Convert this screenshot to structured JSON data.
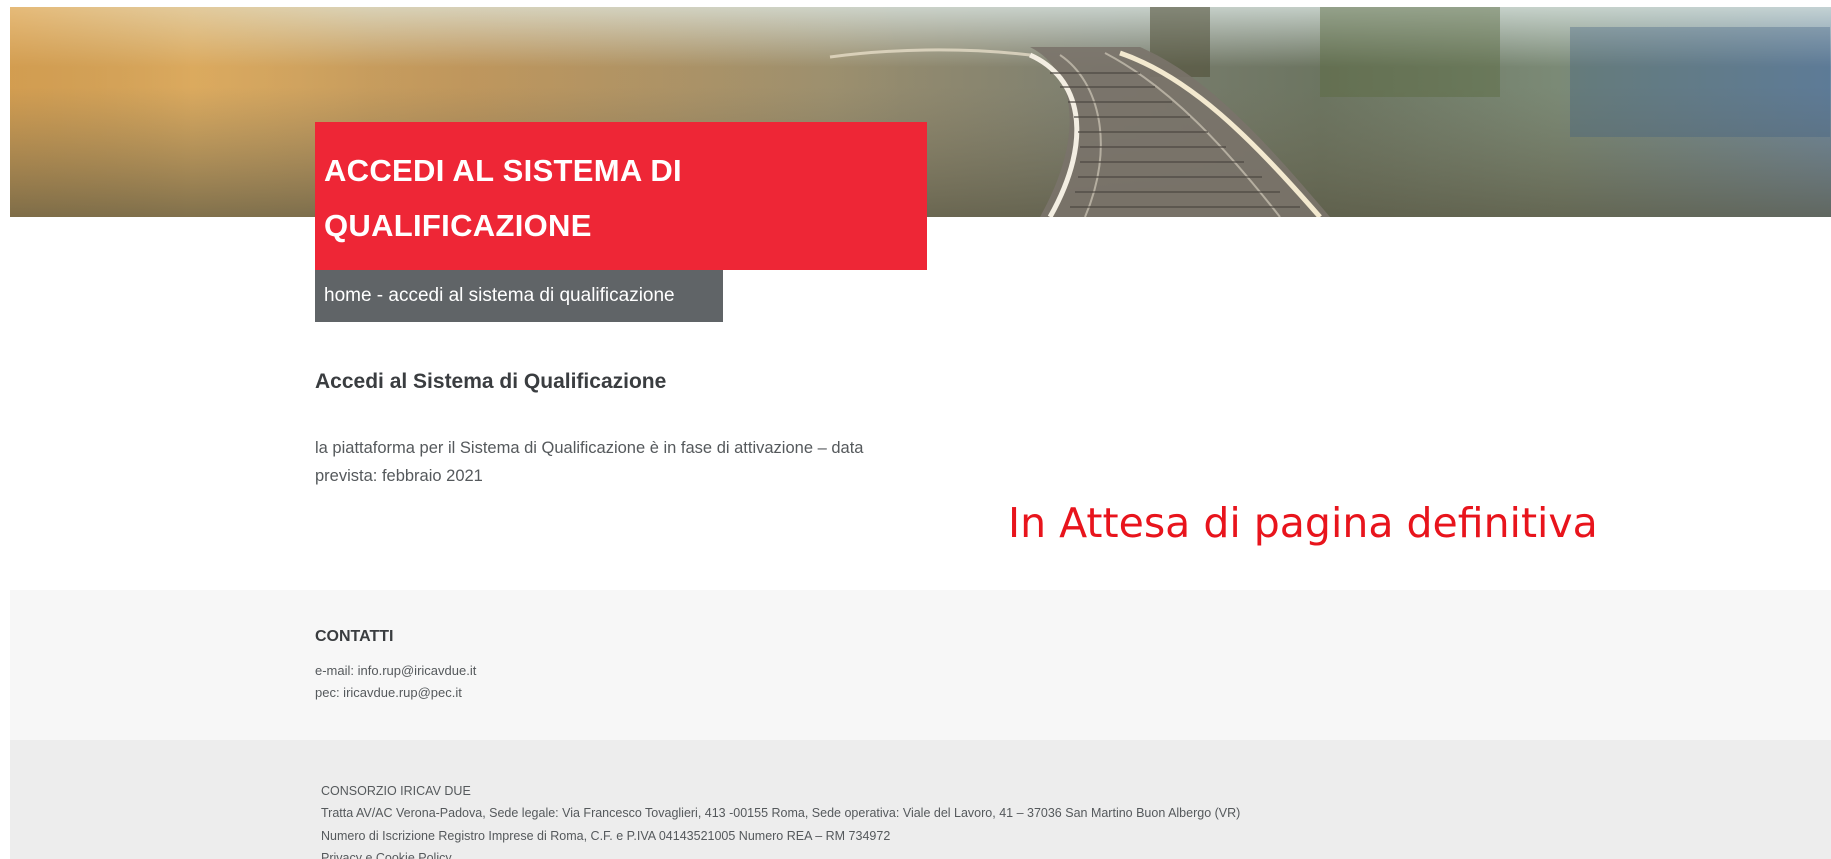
{
  "hero": {
    "title": "ACCEDI AL SISTEMA DI QUALIFICAZIONE",
    "breadcrumb": "home - accedi al sistema di qualificazione",
    "accent_color": "#ee2636",
    "breadcrumb_color": "#606467"
  },
  "main": {
    "heading": "Accedi al Sistema di Qualificazione",
    "body": "la piattaforma per il Sistema di Qualificazione è in fase di attivazione – data prevista: febbraio 2021",
    "pending_note": "In Attesa di pagina definitiva",
    "pending_note_color": "#e8141c"
  },
  "contacts": {
    "heading": "CONTATTI",
    "email": "e-mail: info.rup@iricavdue.it",
    "pec": "pec: iricavdue.rup@pec.it"
  },
  "footer": {
    "company": "CONSORZIO IRICAV DUE",
    "address": "Tratta AV/AC Verona-Padova, Sede legale: Via Francesco Tovaglieri, 413 -00155 Roma, Sede operativa: Viale del Lavoro, 41 – 37036 San Martino Buon Albergo (VR)",
    "registry": "Numero di Iscrizione Registro Imprese di Roma, C.F. e P.IVA 04143521005 Numero REA – RM 734972",
    "privacy_link": "Privacy e Cookie Policy"
  }
}
